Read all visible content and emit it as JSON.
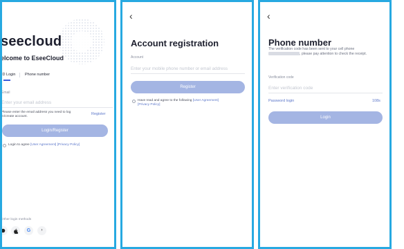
{
  "panel1": {
    "app_name": "seecloud",
    "welcome": "elcome to EseeCloud",
    "tabs": [
      "ID Login",
      "Phone number"
    ],
    "email_label": "Email",
    "email_placeholder": "Enter your email address",
    "hint_text": "Please enter the email address you need to log in/create account.",
    "register_label": "Register",
    "login_button": "Login/Register",
    "agree_prefix": "Login to agree",
    "agreement_link": "[User Agreement]",
    "privacy_link": "[Privacy Policy]",
    "other_login_label": "Other login methods",
    "login_icons": [
      "circle-icon",
      "apple-icon",
      "google-icon",
      "more-icon"
    ]
  },
  "panel2": {
    "back_glyph": "‹",
    "title": "Account registration",
    "account_label": "Account",
    "account_placeholder": "Enter your mobile phone number or email address",
    "register_button": "Register",
    "agree_prefix": "Have read and agree to the following",
    "agreement_link": "[User Agreement]",
    "privacy_link": "[Privacy Policy]"
  },
  "panel3": {
    "back_glyph": "‹",
    "title": "Phone number",
    "message_part1": "The verification code has been sent to your cell phone",
    "message_part2": ", please pay attention to check the receipt.",
    "code_label": "Verification code",
    "code_placeholder": "Enter verification code",
    "password_login": "Password login",
    "countdown": "108s",
    "login_button": "Login"
  },
  "colors": {
    "frame": "#27a9e1",
    "button": "#a4b5e3",
    "link": "#5b76c9"
  }
}
